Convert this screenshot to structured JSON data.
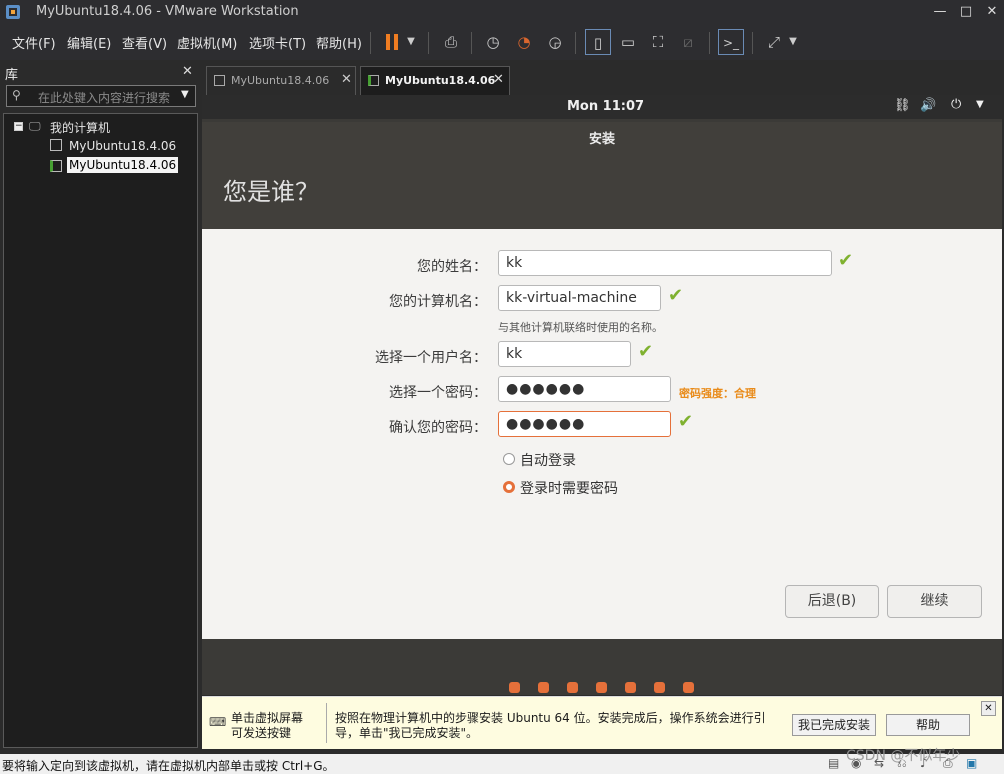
{
  "window": {
    "title": "MyUbuntu18.4.06 - VMware Workstation"
  },
  "menu": {
    "items": [
      "文件(F)",
      "编辑(E)",
      "查看(V)",
      "虚拟机(M)",
      "选项卡(T)",
      "帮助(H)"
    ]
  },
  "library": {
    "title": "库",
    "search_placeholder": "在此处键入内容进行搜索",
    "root": "我的计算机",
    "vms": [
      "MyUbuntu18.4.06",
      "MyUbuntu18.4.06"
    ]
  },
  "tabs": [
    {
      "label": "MyUbuntu18.4.06",
      "active": false
    },
    {
      "label": "MyUbuntu18.4.06",
      "active": true
    }
  ],
  "guest": {
    "clock": "Mon 11:07",
    "dialog_title": "安装",
    "heading": "您是谁？",
    "fields": {
      "name_label": "您的姓名：",
      "name_value": "kk",
      "computer_label": "您的计算机名：",
      "computer_value": "kk-virtual-machine",
      "computer_hint": "与其他计算机联络时使用的名称。",
      "user_label": "选择一个用户名：",
      "user_value": "kk",
      "pass_label": "选择一个密码：",
      "pass_value": "●●●●●●",
      "pass_strength": "密码强度：合理",
      "confirm_label": "确认您的密码：",
      "confirm_value": "●●●●●●"
    },
    "options": {
      "auto_login": "自动登录",
      "require_password": "登录时需要密码"
    },
    "buttons": {
      "back": "后退(B)",
      "continue": "继续"
    },
    "progress_dots": 7
  },
  "infobar": {
    "hint": "单击虚拟屏幕\n可发送按键",
    "message": "按照在物理计算机中的步骤安装 Ubuntu 64 位。安装完成后，操作系统会进行引导，单击\"我已完成安装\"。",
    "done_button": "我已完成安装",
    "help_button": "帮助"
  },
  "status": {
    "text": "要将输入定向到该虚拟机，请在虚拟机内部单击或按 Ctrl+G。"
  },
  "watermark": "CSDN @不似年少",
  "colors": {
    "accent": "#e5703a",
    "check": "#7fb12f",
    "strength": "#e98b1a"
  }
}
